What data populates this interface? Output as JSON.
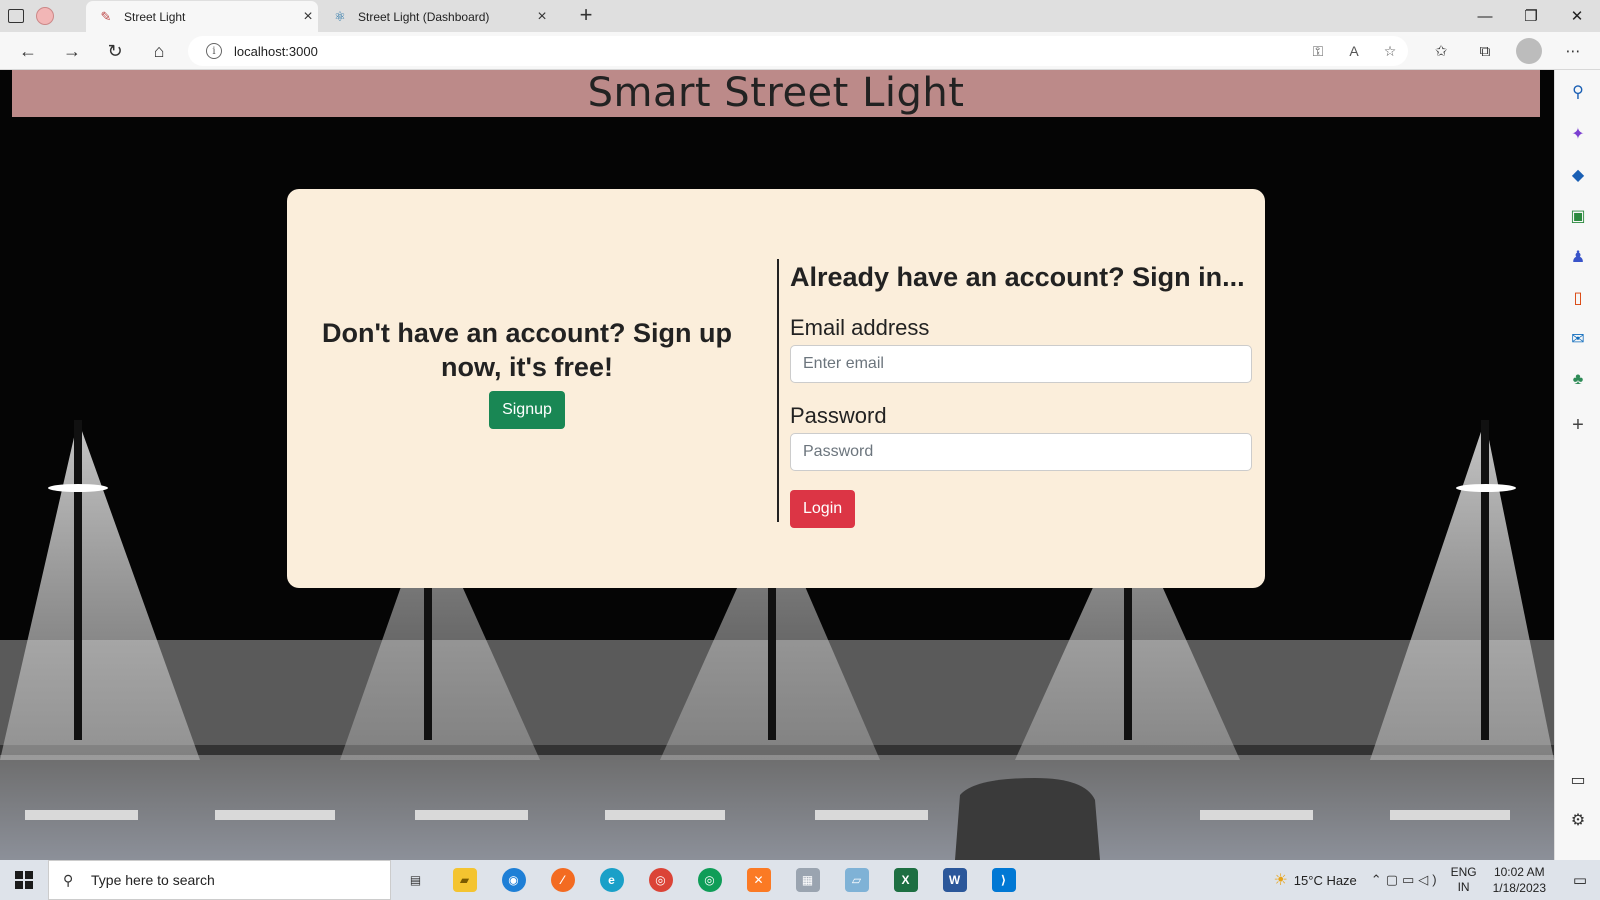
{
  "browser": {
    "tabs": [
      {
        "title": "Street Light",
        "active": true
      },
      {
        "title": "Street Light (Dashboard)",
        "active": false
      }
    ],
    "url": "localhost:3000"
  },
  "page": {
    "header_title": "Smart Street Light",
    "signup": {
      "heading": "Don't have an account? Sign up now, it's free!",
      "button_label": "Signup"
    },
    "signin": {
      "heading": "Already have an account? Sign in...",
      "email_label": "Email address",
      "email_placeholder": "Enter email",
      "password_label": "Password",
      "password_placeholder": "Password",
      "login_button_label": "Login"
    },
    "colors": {
      "header_bg": "#bc8a89",
      "card_bg": "#fbeedb",
      "signup_button": "#198754",
      "login_button": "#dc3545"
    }
  },
  "taskbar": {
    "search_placeholder": "Type here to search",
    "weather": "15°C Haze",
    "language": "ENG",
    "region": "IN",
    "time": "10:02 AM",
    "date": "1/18/2023"
  }
}
